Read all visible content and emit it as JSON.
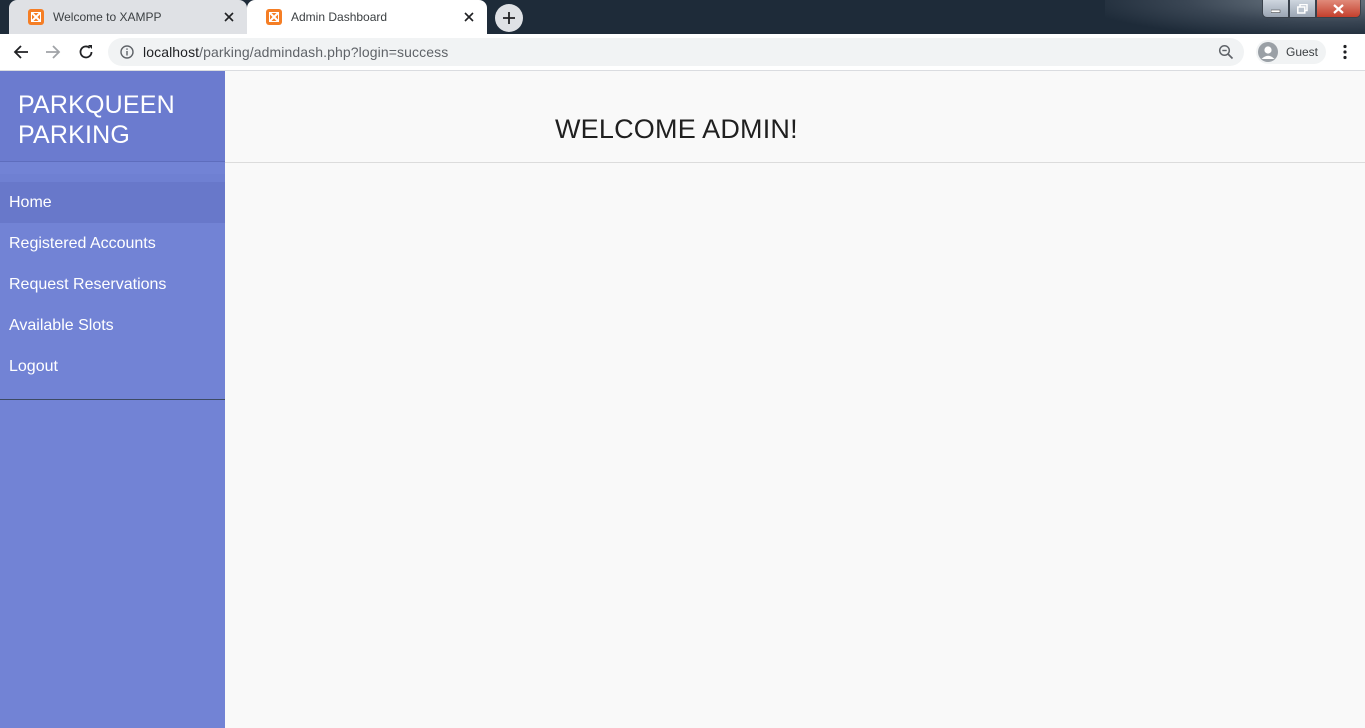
{
  "browser": {
    "tabs": [
      {
        "title": "Welcome to XAMPP",
        "favicon": "xampp-icon",
        "active": false
      },
      {
        "title": "Admin Dashboard",
        "favicon": "xampp-icon",
        "active": true
      }
    ],
    "url": {
      "host": "localhost",
      "path": "/parking/admindash.php?login=success"
    },
    "profile_label": "Guest"
  },
  "sidebar": {
    "brand_line1": "PARKQUEEN",
    "brand_line2": "PARKING",
    "items": [
      {
        "label": "Home",
        "active": true
      },
      {
        "label": "Registered Accounts",
        "active": false
      },
      {
        "label": "Request Reservations",
        "active": false
      },
      {
        "label": "Available Slots",
        "active": false
      },
      {
        "label": "Logout",
        "active": false
      }
    ]
  },
  "main": {
    "welcome": "WELCOME ADMIN!"
  },
  "colors": {
    "sidebar": "#7283d5",
    "brand_bg": "#6b7bcf",
    "active_item": "#6878ca",
    "favicon": "#f57e25"
  }
}
